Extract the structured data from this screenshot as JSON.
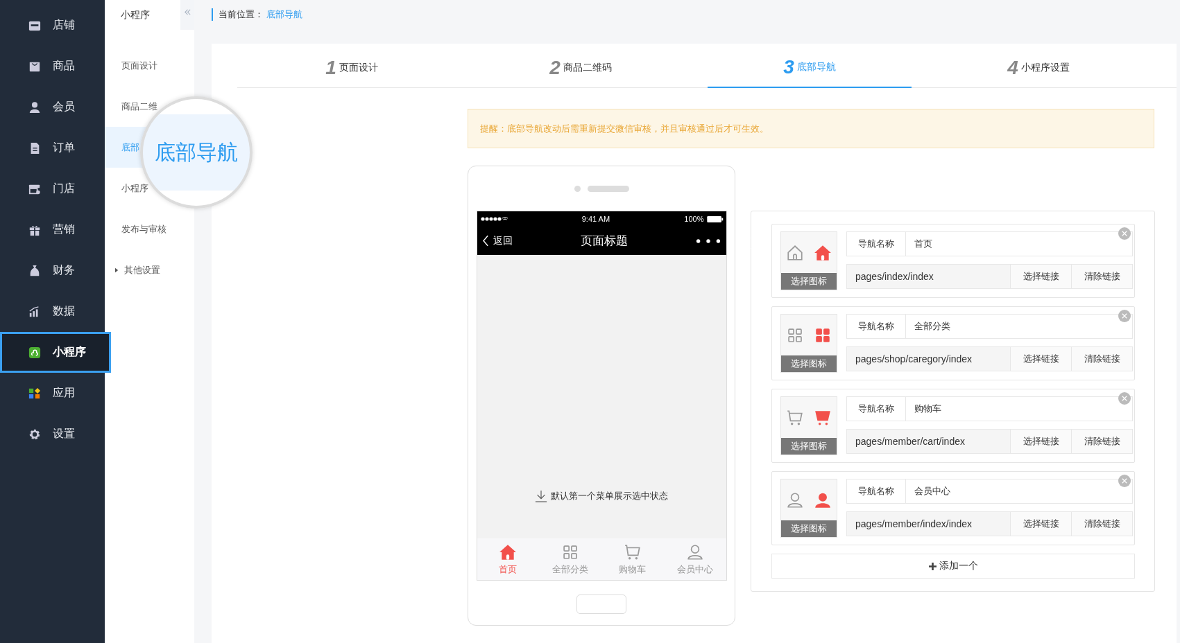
{
  "sidebar": {
    "items": [
      {
        "label": "店铺",
        "selected": false
      },
      {
        "label": "商品",
        "selected": false
      },
      {
        "label": "会员",
        "selected": false
      },
      {
        "label": "订单",
        "selected": false
      },
      {
        "label": "门店",
        "selected": false
      },
      {
        "label": "营销",
        "selected": false
      },
      {
        "label": "财务",
        "selected": false
      },
      {
        "label": "数据",
        "selected": false
      },
      {
        "label": "小程序",
        "selected": true
      },
      {
        "label": "应用",
        "selected": false
      },
      {
        "label": "设置",
        "selected": false
      }
    ]
  },
  "sub_nav": {
    "title": "小程序",
    "items": [
      {
        "label": "页面设计",
        "kind": "page",
        "selected": false
      },
      {
        "label": "商品二维",
        "kind": "page",
        "selected": false
      },
      {
        "label": "底部",
        "kind": "page",
        "selected": true
      },
      {
        "label": "小程序",
        "kind": "page",
        "selected": false
      },
      {
        "label": "发布与审核",
        "kind": "page",
        "selected": false
      },
      {
        "label": "其他设置",
        "kind": "group",
        "expanded": false,
        "selected": false
      }
    ]
  },
  "magnifier": {
    "label": "底部导航"
  },
  "breadcrumb": {
    "label": "当前位置：",
    "current": "底部导航"
  },
  "steps": [
    {
      "number": "1",
      "label": "页面设计",
      "selected": false
    },
    {
      "number": "2",
      "label": "商品二维码",
      "selected": false
    },
    {
      "number": "3",
      "label": "底部导航",
      "selected": true
    },
    {
      "number": "4",
      "label": "小程序设置",
      "selected": false
    }
  ],
  "notice": "提醒：底部导航改动后需重新提交微信审核，并且审核通过后才可生效。",
  "phone": {
    "status": {
      "time": "9:41 AM",
      "battery": "100%"
    },
    "back": "返回",
    "title": "页面标题",
    "hint": "默认第一个菜单展示选中状态",
    "tabbar": [
      {
        "label": "首页",
        "selected": true
      },
      {
        "label": "全部分类",
        "selected": false
      },
      {
        "label": "购物车",
        "selected": false
      },
      {
        "label": "会员中心",
        "selected": false
      }
    ]
  },
  "nav_editor": {
    "items": [
      {
        "name_label": "导航名称",
        "name": "首页",
        "path": "pages/index/index",
        "choose_icon": "选择图标",
        "select_link": "选择链接",
        "clear_link": "清除链接"
      },
      {
        "name_label": "导航名称",
        "name": "全部分类",
        "path": "pages/shop/caregory/index",
        "choose_icon": "选择图标",
        "select_link": "选择链接",
        "clear_link": "清除链接"
      },
      {
        "name_label": "导航名称",
        "name": "购物车",
        "path": "pages/member/cart/index",
        "choose_icon": "选择图标",
        "select_link": "选择链接",
        "clear_link": "清除链接"
      },
      {
        "name_label": "导航名称",
        "name": "会员中心",
        "path": "pages/member/index/index",
        "choose_icon": "选择图标",
        "select_link": "选择链接",
        "clear_link": "清除链接"
      }
    ],
    "add": "添加一个"
  }
}
